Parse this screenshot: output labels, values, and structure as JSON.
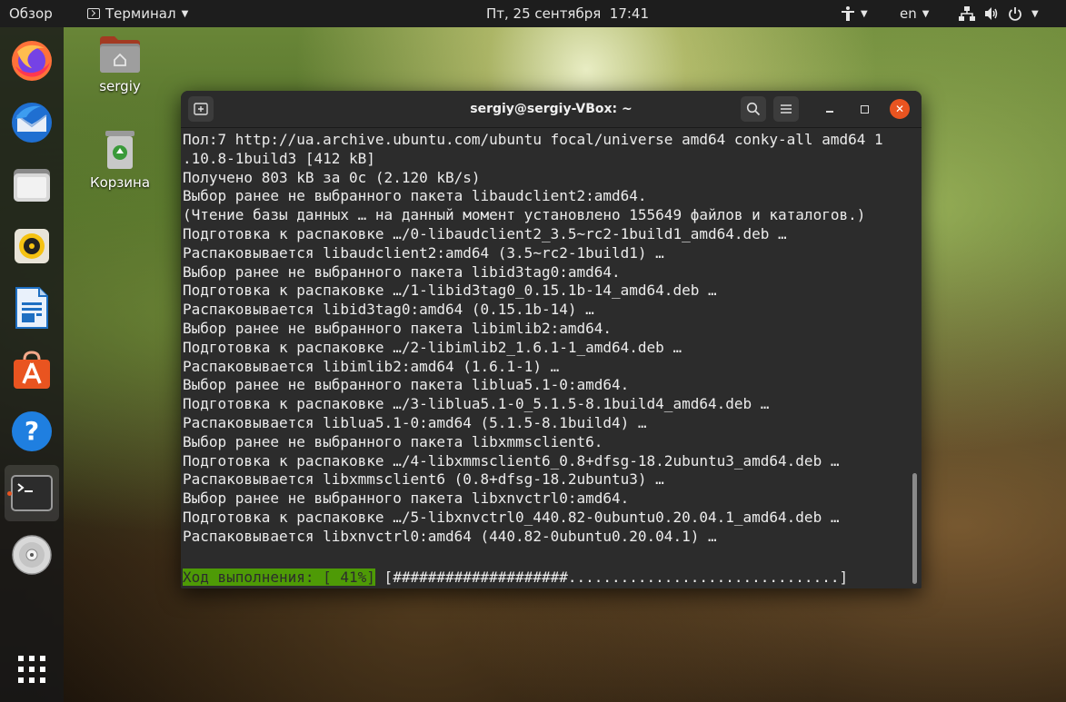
{
  "topbar": {
    "activities": "Обзор",
    "app_menu": "Терминал",
    "clock": "Пт, 25 сентября  17:41",
    "lang": "en"
  },
  "desktop": {
    "home_label": "sergiy",
    "trash_label": "Корзина"
  },
  "window": {
    "title": "sergiy@sergiy-VBox: ~"
  },
  "terminal": {
    "lines": [
      "Пол:7 http://ua.archive.ubuntu.com/ubuntu focal/universe amd64 conky-all amd64 1",
      ".10.8-1build3 [412 kB]",
      "Получено 803 kB за 0с (2.120 kB/s)",
      "Выбор ранее не выбранного пакета libaudclient2:amd64.",
      "(Чтение базы данных … на данный момент установлено 155649 файлов и каталогов.)",
      "Подготовка к распаковке …/0-libaudclient2_3.5~rc2-1build1_amd64.deb …",
      "Распаковывается libaudclient2:amd64 (3.5~rc2-1build1) …",
      "Выбор ранее не выбранного пакета libid3tag0:amd64.",
      "Подготовка к распаковке …/1-libid3tag0_0.15.1b-14_amd64.deb …",
      "Распаковывается libid3tag0:amd64 (0.15.1b-14) …",
      "Выбор ранее не выбранного пакета libimlib2:amd64.",
      "Подготовка к распаковке …/2-libimlib2_1.6.1-1_amd64.deb …",
      "Распаковывается libimlib2:amd64 (1.6.1-1) …",
      "Выбор ранее не выбранного пакета liblua5.1-0:amd64.",
      "Подготовка к распаковке …/3-liblua5.1-0_5.1.5-8.1build4_amd64.deb …",
      "Распаковывается liblua5.1-0:amd64 (5.1.5-8.1build4) …",
      "Выбор ранее не выбранного пакета libxmmsclient6.",
      "Подготовка к распаковке …/4-libxmmsclient6_0.8+dfsg-18.2ubuntu3_amd64.deb …",
      "Распаковывается libxmmsclient6 (0.8+dfsg-18.2ubuntu3) …",
      "Выбор ранее не выбранного пакета libxnvctrl0:amd64.",
      "Подготовка к распаковке …/5-libxnvctrl0_440.82-0ubuntu0.20.04.1_amd64.deb …",
      "Распаковывается libxnvctrl0:amd64 (440.82-0ubuntu0.20.04.1) …"
    ],
    "progress_label": "Ход выполнения: [ 41%]",
    "progress_bar": " [####################...............................]"
  },
  "colors": {
    "accent": "#e95420",
    "progress_bg": "#4e9a06",
    "terminal_bg": "#2c2c2c"
  },
  "icons": {
    "dock": [
      "firefox-icon",
      "thunderbird-icon",
      "files-icon",
      "rhythmbox-icon",
      "libreoffice-writer-icon",
      "software-center-icon",
      "help-icon",
      "terminal-icon",
      "dvd-icon",
      "show-apps-icon"
    ]
  }
}
